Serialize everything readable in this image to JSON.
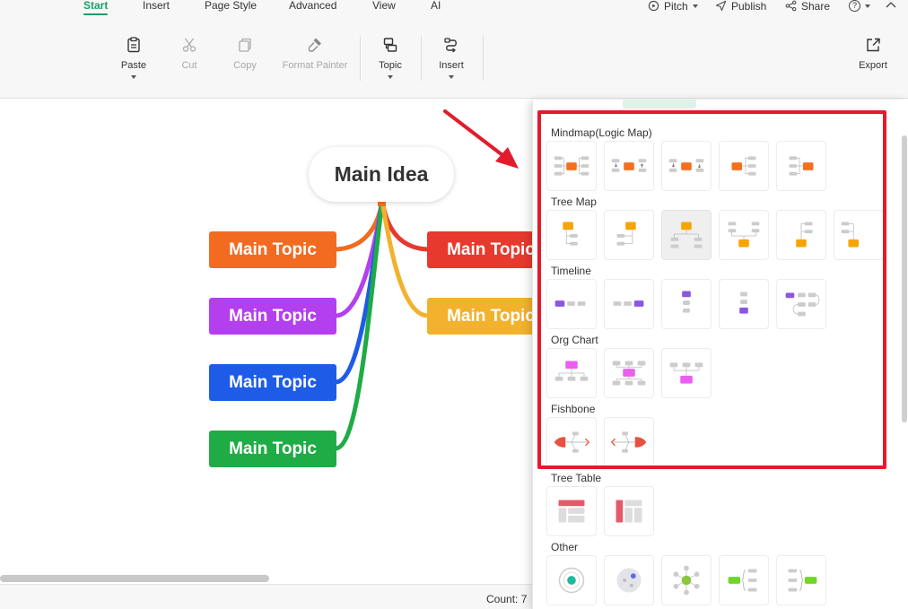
{
  "menu": {
    "tabs": [
      "Start",
      "Insert",
      "Page Style",
      "Advanced",
      "View",
      "AI"
    ],
    "active": "Start",
    "right_actions": {
      "pitch": "Pitch",
      "publish": "Publish",
      "share": "Share",
      "help": "?"
    }
  },
  "toolbar": {
    "paste": "Paste",
    "cut": "Cut",
    "copy": "Copy",
    "format_painter": "Format Painter",
    "topic": "Topic",
    "insert": "Insert",
    "export": "Export"
  },
  "mindmap": {
    "central": "Main Idea",
    "topics": [
      {
        "label": "Main Topic",
        "color": "#f26b21"
      },
      {
        "label": "Main Topic",
        "color": "#b43fef"
      },
      {
        "label": "Main Topic",
        "color": "#1e5ce8"
      },
      {
        "label": "Main Topic",
        "color": "#1fab46"
      },
      {
        "label": "Main Topic",
        "color": "#e8392e"
      },
      {
        "label": "Main Topic",
        "color": "#f3b22d"
      }
    ]
  },
  "layout_panel": {
    "sections": [
      {
        "title": "Mindmap(Logic Map)",
        "count": 5
      },
      {
        "title": "Tree Map",
        "count": 6,
        "selected": 2
      },
      {
        "title": "Timeline",
        "count": 5
      },
      {
        "title": "Org Chart",
        "count": 3
      },
      {
        "title": "Fishbone",
        "count": 2
      },
      {
        "title": "Tree Table",
        "count": 2
      },
      {
        "title": "Other",
        "count": 5
      }
    ]
  },
  "status": {
    "count": "Count: 7"
  },
  "colors": {
    "accent": "#1a9e6b",
    "highlight": "#e21b2d",
    "mindmap_node": "#f37021",
    "tree_node": "#f6a500",
    "timeline_node": "#8a56e2",
    "org_node": "#ea5ff0",
    "fishbone": "#e8503f",
    "table": "#e45a6a",
    "other_teal": "#1fb89a",
    "other_green": "#6fd62a"
  }
}
